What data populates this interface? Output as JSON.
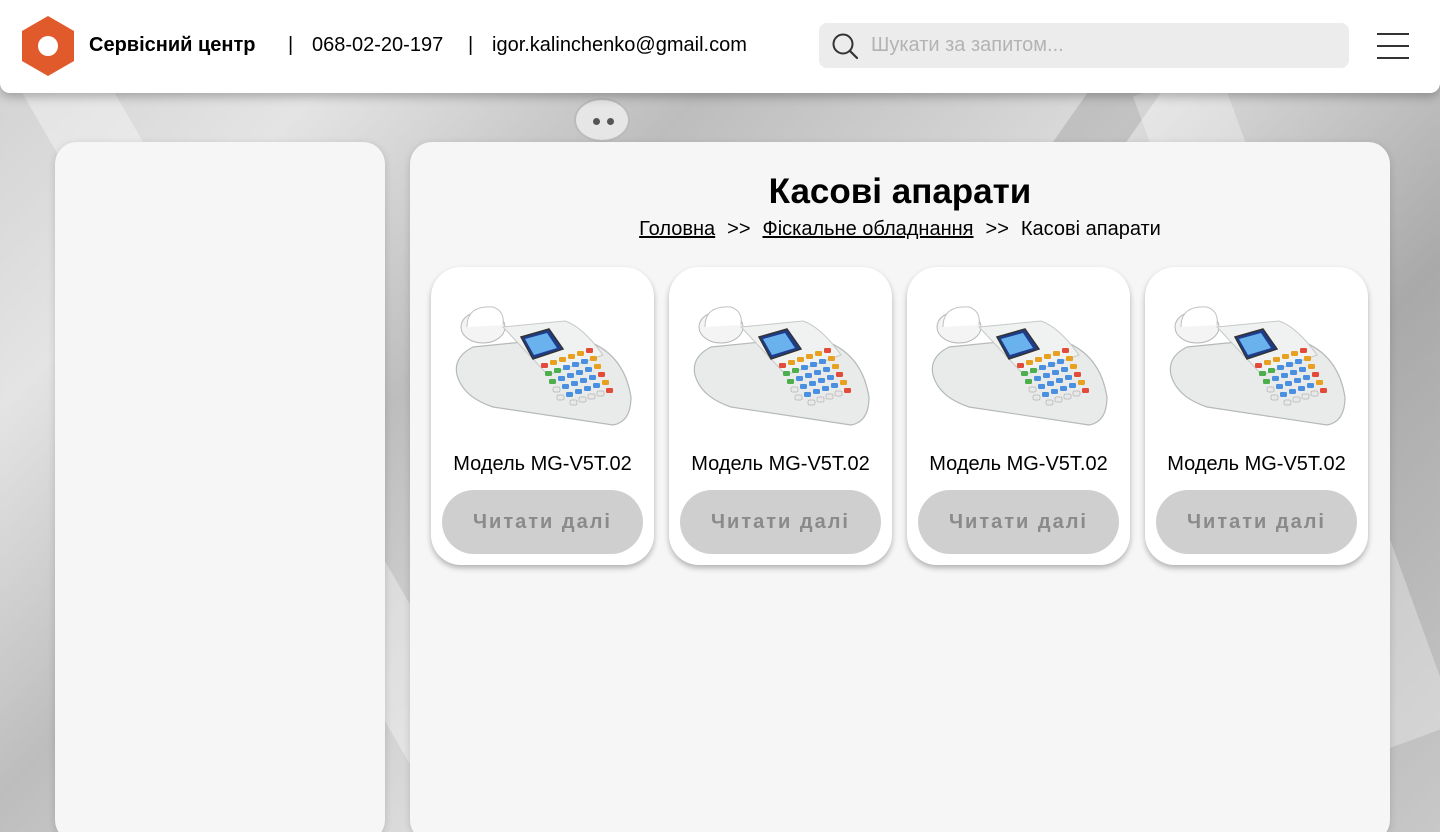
{
  "header": {
    "brand": "Сервісний центр",
    "separator": "|",
    "phone": "068-02-20-197",
    "email": "igor.kalinchenko@gmail.com",
    "search_placeholder": "Шукати за запитом...",
    "logo_icon": "hexagon-logo-icon",
    "menu_icon": "hamburger-menu-icon",
    "search_icon": "search-icon"
  },
  "colors": {
    "logo": "#e05a2b",
    "button_bg": "#cfcfcf",
    "button_text": "#8a8a8a",
    "panel_bg": "#f6f6f6"
  },
  "main": {
    "title": "Касові апарати",
    "breadcrumb": {
      "home": "Головна",
      "arrow": ">>",
      "category": "Фіскальне обладнання",
      "current": "Касові апарати"
    },
    "products": [
      {
        "name": "Модель MG-V5T.02",
        "button": "Читати далі",
        "image": "cash-register-image"
      },
      {
        "name": "Модель MG-V5T.02",
        "button": "Читати далі",
        "image": "cash-register-image"
      },
      {
        "name": "Модель MG-V5T.02",
        "button": "Читати далі",
        "image": "cash-register-image"
      },
      {
        "name": "Модель MG-V5T.02",
        "button": "Читати далі",
        "image": "cash-register-image"
      }
    ]
  }
}
